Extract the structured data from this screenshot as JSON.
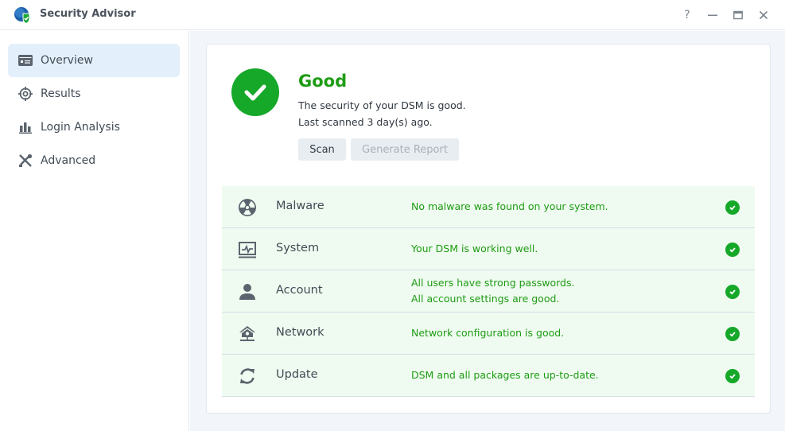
{
  "window": {
    "title": "Security Advisor",
    "controls": {
      "help": "?",
      "minimize": "—",
      "maximize": "▭",
      "close": "✕"
    }
  },
  "sidebar": {
    "items": [
      {
        "label": "Overview",
        "icon": "overview-card-icon",
        "active": true
      },
      {
        "label": "Results",
        "icon": "crosshair-icon",
        "active": false
      },
      {
        "label": "Login Analysis",
        "icon": "bar-chart-icon",
        "active": false
      },
      {
        "label": "Advanced",
        "icon": "tools-icon",
        "active": false
      }
    ]
  },
  "status": {
    "title": "Good",
    "description": "The security of your DSM is good.",
    "last_scanned": "Last scanned 3 day(s) ago.",
    "scan_label": "Scan",
    "report_label": "Generate Report",
    "color": "#1e9c14"
  },
  "checks": [
    {
      "name": "Malware",
      "icon": "radiation-icon",
      "messages": [
        "No malware was found on your system."
      ],
      "status": "ok"
    },
    {
      "name": "System",
      "icon": "system-monitor-icon",
      "messages": [
        "Your DSM is working well."
      ],
      "status": "ok"
    },
    {
      "name": "Account",
      "icon": "user-icon",
      "messages": [
        "All users have strong passwords.",
        "All account settings are good."
      ],
      "status": "ok"
    },
    {
      "name": "Network",
      "icon": "network-home-icon",
      "messages": [
        "Network configuration is good."
      ],
      "status": "ok"
    },
    {
      "name": "Update",
      "icon": "refresh-icon",
      "messages": [
        "DSM and all packages are up-to-date."
      ],
      "status": "ok"
    }
  ]
}
